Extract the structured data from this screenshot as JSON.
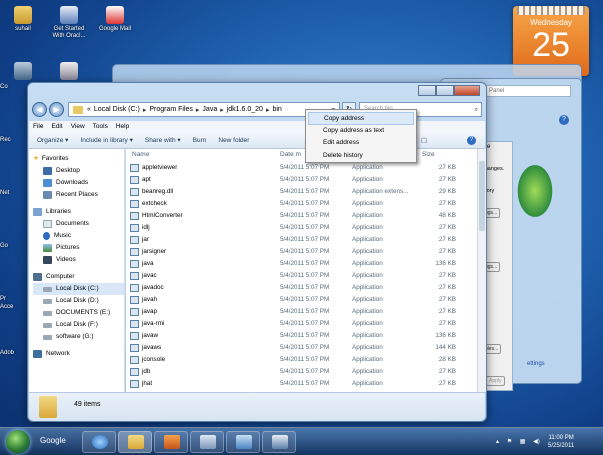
{
  "desktop": {
    "icons": [
      {
        "label": "suhail"
      },
      {
        "label": "Get Started With Oracl..."
      },
      {
        "label": "Google Mail"
      }
    ],
    "side_labels": [
      "Co",
      "Rec",
      "Net",
      "Go",
      "Pr",
      "Acce",
      "Adob"
    ]
  },
  "gadget": {
    "weekday": "Wednesday",
    "day": "25"
  },
  "background_window": {
    "search_hint": "Panel",
    "tab_label": "ite",
    "text_1": "changes.",
    "text_2": "mory",
    "button_1": "ngs...",
    "button_2": "ngs...",
    "button_3": "iables...",
    "link": "ettings",
    "apply": "Apply",
    "help": "?"
  },
  "explorer": {
    "breadcrumb": [
      "Local Disk (C:)",
      "Program Files",
      "Java",
      "jdk1.6.0_20",
      "bin"
    ],
    "breadcrumb_prefix": "«",
    "search_placeholder": "Search bin",
    "menu": [
      "File",
      "Edit",
      "View",
      "Tools",
      "Help"
    ],
    "toolbar": [
      "Organize ▾",
      "Include in library ▾",
      "Share with ▾",
      "Burn",
      "New folder"
    ],
    "columns": {
      "name": "Name",
      "date": "Date m",
      "size": "Size"
    },
    "nav": {
      "favorites": "Favorites",
      "favorites_items": [
        "Desktop",
        "Downloads",
        "Recent Places"
      ],
      "libraries": "Libraries",
      "libraries_items": [
        "Documents",
        "Music",
        "Pictures",
        "Videos"
      ],
      "computer": "Computer",
      "computer_items": [
        "Local Disk (C:)",
        "Local Disk (D:)",
        "DOCUMENTS (E:)",
        "Local Disk (F:)",
        "software (G:)"
      ],
      "network": "Network"
    },
    "files": [
      {
        "name": "appletviewer",
        "date": "5/4/2011 5:07 PM",
        "type": "Application",
        "size": "27 KB"
      },
      {
        "name": "apt",
        "date": "5/4/2011 5:07 PM",
        "type": "Application",
        "size": "27 KB"
      },
      {
        "name": "beanreg.dll",
        "date": "5/4/2011 5:07 PM",
        "type": "Application extens...",
        "size": "29 KB"
      },
      {
        "name": "extcheck",
        "date": "5/4/2011 5:07 PM",
        "type": "Application",
        "size": "27 KB"
      },
      {
        "name": "HtmlConverter",
        "date": "5/4/2011 5:07 PM",
        "type": "Application",
        "size": "48 KB"
      },
      {
        "name": "idlj",
        "date": "5/4/2011 5:07 PM",
        "type": "Application",
        "size": "27 KB"
      },
      {
        "name": "jar",
        "date": "5/4/2011 5:07 PM",
        "type": "Application",
        "size": "27 KB"
      },
      {
        "name": "jarsigner",
        "date": "5/4/2011 5:07 PM",
        "type": "Application",
        "size": "27 KB"
      },
      {
        "name": "java",
        "date": "5/4/2011 5:07 PM",
        "type": "Application",
        "size": "136 KB"
      },
      {
        "name": "javac",
        "date": "5/4/2011 5:07 PM",
        "type": "Application",
        "size": "27 KB"
      },
      {
        "name": "javadoc",
        "date": "5/4/2011 5:07 PM",
        "type": "Application",
        "size": "27 KB"
      },
      {
        "name": "javah",
        "date": "5/4/2011 5:07 PM",
        "type": "Application",
        "size": "27 KB"
      },
      {
        "name": "javap",
        "date": "5/4/2011 5:07 PM",
        "type": "Application",
        "size": "27 KB"
      },
      {
        "name": "java-rmi",
        "date": "5/4/2011 5:07 PM",
        "type": "Application",
        "size": "27 KB"
      },
      {
        "name": "javaw",
        "date": "5/4/2011 5:07 PM",
        "type": "Application",
        "size": "136 KB"
      },
      {
        "name": "javaws",
        "date": "5/4/2011 5:07 PM",
        "type": "Application",
        "size": "144 KB"
      },
      {
        "name": "jconsole",
        "date": "5/4/2011 5:07 PM",
        "type": "Application",
        "size": "28 KB"
      },
      {
        "name": "jdb",
        "date": "5/4/2011 5:07 PM",
        "type": "Application",
        "size": "27 KB"
      },
      {
        "name": "jhat",
        "date": "5/4/2011 5:07 PM",
        "type": "Application",
        "size": "27 KB"
      }
    ],
    "item_count": "49 items"
  },
  "context_menu": [
    "Copy address",
    "Copy address as text",
    "Edit address",
    "Delete history"
  ],
  "taskbar": {
    "google": "Google",
    "time": "11:00 PM",
    "date": "5/25/2011"
  },
  "colors": {
    "accent": "#1f62b0",
    "gadget": "#e06a1a",
    "selection": "#d8e7f7"
  }
}
